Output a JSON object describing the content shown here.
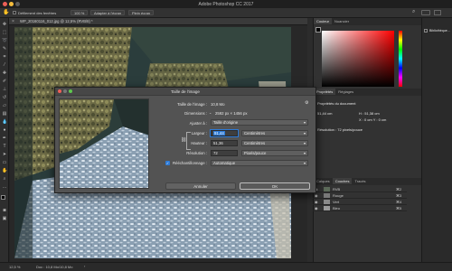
{
  "app": {
    "title": "Adobe Photoshop CC 2017"
  },
  "options_bar": {
    "scroll_all": "Défilement des fenêtres",
    "zoom_100": "100 %",
    "fit_screen": "Adapter à l'écran",
    "fill_screen": "Plein écran"
  },
  "document": {
    "tab_label": "WP_20160116_012.jpg @ 12,5% (RVB/8) *",
    "zoom": "12,5 %",
    "doc_size": "Doc : 10,8 Mo/10,8 Mo"
  },
  "right_panel": {
    "tabs": [
      "Couleur",
      "Nuancier"
    ],
    "library_label": "Bibliothèque...",
    "props_tabs": [
      "Propriétés",
      "Réglages"
    ],
    "props_title": "Propriétés du document",
    "props_w": "51,44 cm",
    "props_h": "H : 51,38 cm",
    "props_xy": "X : 0 cm   Y : 0 cm",
    "props_res": "Résolution : 72 pixels/pouce",
    "layer_tabs": [
      "Calques",
      "Couches",
      "Tracés"
    ],
    "channels": [
      "RVB",
      "Rouge",
      "Vert",
      "Bleu"
    ],
    "shortcuts": [
      "⌘2",
      "⌘3",
      "⌘4",
      "⌘5"
    ]
  },
  "dialog": {
    "title": "Taille de l'image",
    "size_label": "Taille de l'image :",
    "size_value": "10,8 Mo",
    "dim_label": "Dimensions :",
    "dim_value": "2592 px × 1456 px",
    "fit_label": "Ajuster à :",
    "fit_value": "Taille d'origine",
    "width_label": "Largeur :",
    "width_value": "91,44",
    "width_unit": "Centimètres",
    "height_label": "Hauteur :",
    "height_value": "51,36",
    "height_unit": "Centimètres",
    "res_label": "Résolution :",
    "res_value": "72",
    "res_unit": "Pixels/pouce",
    "resample_label": "Rééchantillonnage :",
    "resample_value": "Automatique",
    "cancel": "Annuler",
    "ok": "OK"
  },
  "colors": {
    "accent": "#2d7ad6",
    "foreground": "#000000",
    "background": "#ffffff"
  }
}
